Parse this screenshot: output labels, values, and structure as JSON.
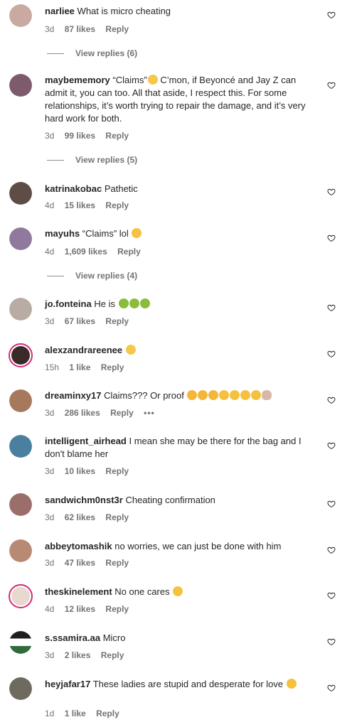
{
  "comments": [
    {
      "user": "narliee",
      "text": "What is micro cheating",
      "time": "3d",
      "likes": "87 likes",
      "reply": "Reply",
      "replies": "View replies (6)",
      "avatar": "#c9a9a0"
    },
    {
      "user": "maybememory",
      "text": "“Claims”",
      "text2": " C’mon, if Beyoncé and Jay Z can admit it, you can too. All that aside, I respect this. For some relationships, it’s worth trying to repair the damage, and it’s very hard work for both.",
      "time": "3d",
      "likes": "99 likes",
      "reply": "Reply",
      "replies": "View replies (5)",
      "avatar": "#7d5a6e"
    },
    {
      "user": "katrinakobac",
      "text": "Pathetic",
      "time": "4d",
      "likes": "15 likes",
      "reply": "Reply",
      "avatar": "#5e4c46"
    },
    {
      "user": "mayuhs",
      "text": "“Claims” lol",
      "time": "4d",
      "likes": "1,609 likes",
      "reply": "Reply",
      "replies": "View replies (4)",
      "avatar": "#8f7a9e"
    },
    {
      "user": "jo.fonteina",
      "text": "He is",
      "time": "3d",
      "likes": "67 likes",
      "reply": "Reply",
      "avatar": "#b8aca4"
    },
    {
      "user": "alexzandrareenee",
      "text": "",
      "time": "15h",
      "likes": "1 like",
      "reply": "Reply",
      "avatar": "#3a2a28"
    },
    {
      "user": "dreaminxy17",
      "text": "Claims??? Or proof",
      "time": "3d",
      "likes": "286 likes",
      "reply": "Reply",
      "more": "•••",
      "avatar": "#a6785c"
    },
    {
      "user": "intelligent_airhead",
      "text": "I mean she may be there for the bag and I don't blame her",
      "time": "3d",
      "likes": "10 likes",
      "reply": "Reply",
      "avatar": "#4a7fa0"
    },
    {
      "user": "sandwichm0nst3r",
      "text": "Cheating confirmation",
      "time": "3d",
      "likes": "62 likes",
      "reply": "Reply",
      "avatar": "#9b6f69"
    },
    {
      "user": "abbeytomashik",
      "text": "no worries, we can just be done with him",
      "time": "3d",
      "likes": "47 likes",
      "reply": "Reply",
      "avatar": "#b88a74"
    },
    {
      "user": "theskinelement",
      "text": "No one cares",
      "time": "4d",
      "likes": "12 likes",
      "reply": "Reply",
      "avatar": "#e7d9cf"
    },
    {
      "user": "s.ssamira.aa",
      "text": "Micro",
      "time": "3d",
      "likes": "2 likes",
      "reply": "Reply",
      "avatar": "#2f6b3c"
    },
    {
      "user": "heyjafar17",
      "text": "These ladies are stupid and desperate for love",
      "time": "1d",
      "likes": "1 like",
      "reply": "Reply",
      "avatar": "#6f6a60"
    }
  ]
}
